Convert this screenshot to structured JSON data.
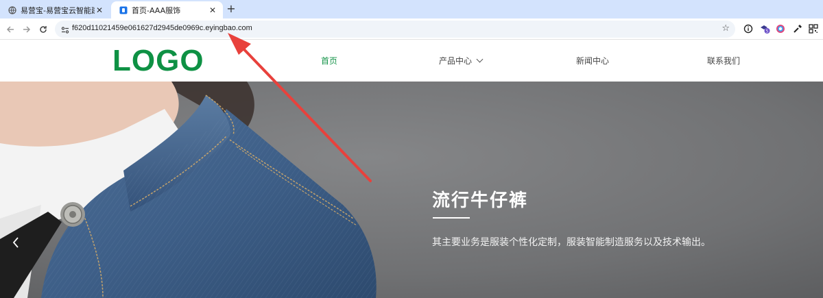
{
  "browser": {
    "tabs": [
      {
        "title": "易营宝-易营宝云智能建站营销",
        "state": "inactive",
        "icon": "globe-icon"
      },
      {
        "title": "首页-AAA服饰",
        "state": "active",
        "icon": "site-favicon"
      }
    ],
    "close_glyph": "✕",
    "newtab_glyph": "+",
    "url": "f620d11021459e061627d2945de0969c.eyingbao.com",
    "bookmark_glyph": "☆"
  },
  "site": {
    "logo": "LOGO",
    "nav": [
      {
        "label": "首页",
        "active": true
      },
      {
        "label": "产品中心",
        "active": false,
        "dropdown": true
      },
      {
        "label": "新闻中心",
        "active": false
      },
      {
        "label": "联系我们",
        "active": false
      }
    ]
  },
  "hero": {
    "title": "流行牛仔裤",
    "description": "其主要业务是服装个性化定制，服装智能制造服务以及技术输出。"
  },
  "colors": {
    "brand_green": "#0e9144",
    "nav_active": "#16944a",
    "annotation_red": "#e8413c",
    "tabstrip": "#d3e3fd"
  }
}
